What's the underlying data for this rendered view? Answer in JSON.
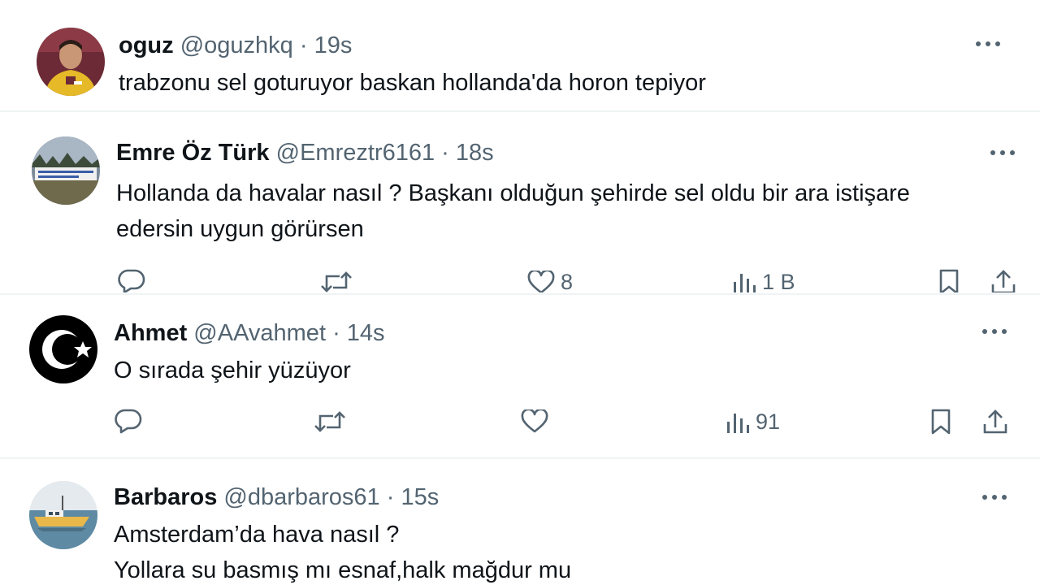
{
  "tweets": [
    {
      "name": "oguz",
      "handle": "@oguzhkq",
      "separator": "·",
      "time": "19s",
      "lines": [
        "trabzonu sel goturuyor baskan hollanda'da horon tepiyor"
      ],
      "avatar_icon": "profile-photo-player"
    },
    {
      "name": "Emre Öz Türk",
      "handle": "@Emreztr6161",
      "separator": "·",
      "time": "18s",
      "lines": [
        "Hollanda da havalar nasıl ?  Başkanı olduğun şehirde sel oldu bir ara istişare",
        "edersin uygun görürsen"
      ],
      "avatar_icon": "profile-photo-banner",
      "likes": "8",
      "views": "1 B"
    },
    {
      "name": "Ahmet",
      "handle": "@AAvahmet",
      "separator": "·",
      "time": "14s",
      "lines": [
        "O sırada şehir yüzüyor"
      ],
      "avatar_icon": "crescent-star-icon",
      "likes": "",
      "views": "91"
    },
    {
      "name": "Barbaros",
      "handle": "@dbarbaros61",
      "separator": "·",
      "time": "15s",
      "lines": [
        "Amsterdam’da hava nasıl ?",
        "Yollara su basmış mı esnaf,halk mağdur mu"
      ],
      "avatar_icon": "profile-photo-boat"
    }
  ],
  "colors": {
    "text": "#0f1419",
    "secondary": "#536471",
    "divider": "#eff3f4"
  }
}
